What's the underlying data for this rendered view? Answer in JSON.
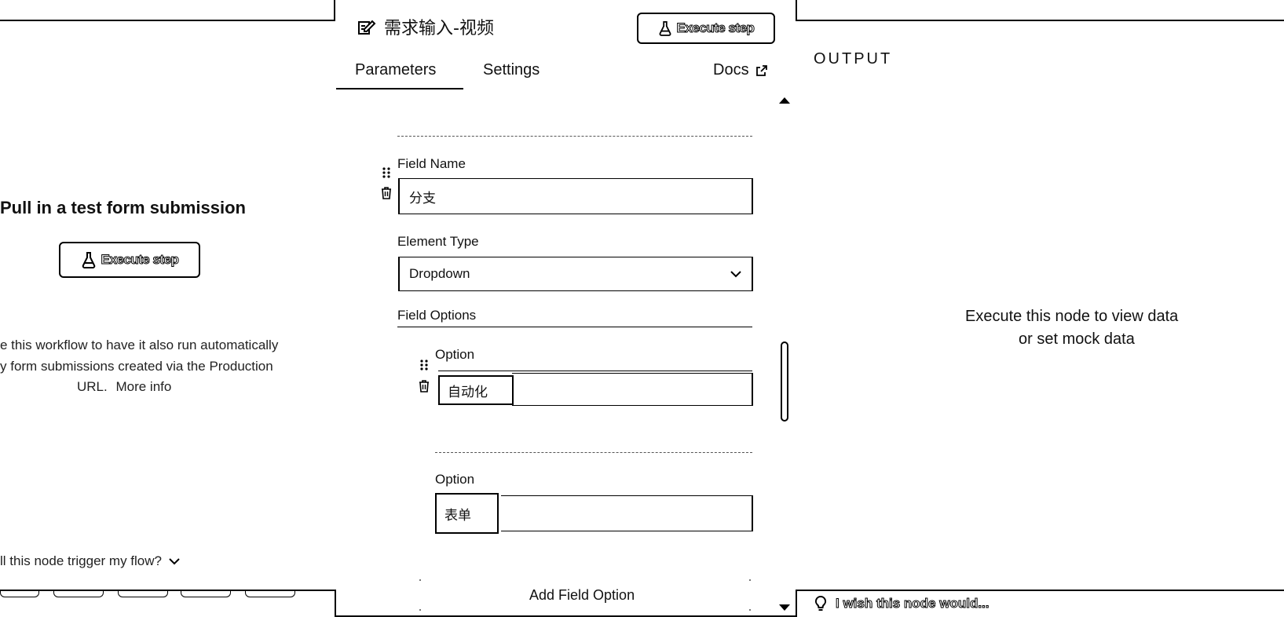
{
  "node": {
    "title": "需求输入-视频",
    "execute_label": "Execute step"
  },
  "tabs": [
    {
      "label": "Parameters"
    },
    {
      "label": "Settings"
    }
  ],
  "docs_label": "Docs",
  "left_panel": {
    "heading": "Pull in a test form submission",
    "execute_label": "Execute step",
    "description_line1": "e this workflow to have it also run automatically",
    "description_line2": "y form submissions created via the Production",
    "description_line3": "URL.",
    "more_info": "More info",
    "trigger_question": "ll this node trigger my flow?"
  },
  "form": {
    "field_name_label": "Field Name",
    "field_name_value": "分支",
    "element_type_label": "Element Type",
    "element_type_value": "Dropdown",
    "field_options_label": "Field Options",
    "options": [
      {
        "label": "Option",
        "value": "自动化"
      },
      {
        "label": "Option",
        "value": "表单"
      }
    ],
    "add_option_label": "Add Field Option"
  },
  "output": {
    "heading": "OUTPUT",
    "empty_line1": "Execute this node to view data",
    "empty_line2": "or set mock data"
  },
  "feedback": {
    "label": "I wish this node would..."
  }
}
